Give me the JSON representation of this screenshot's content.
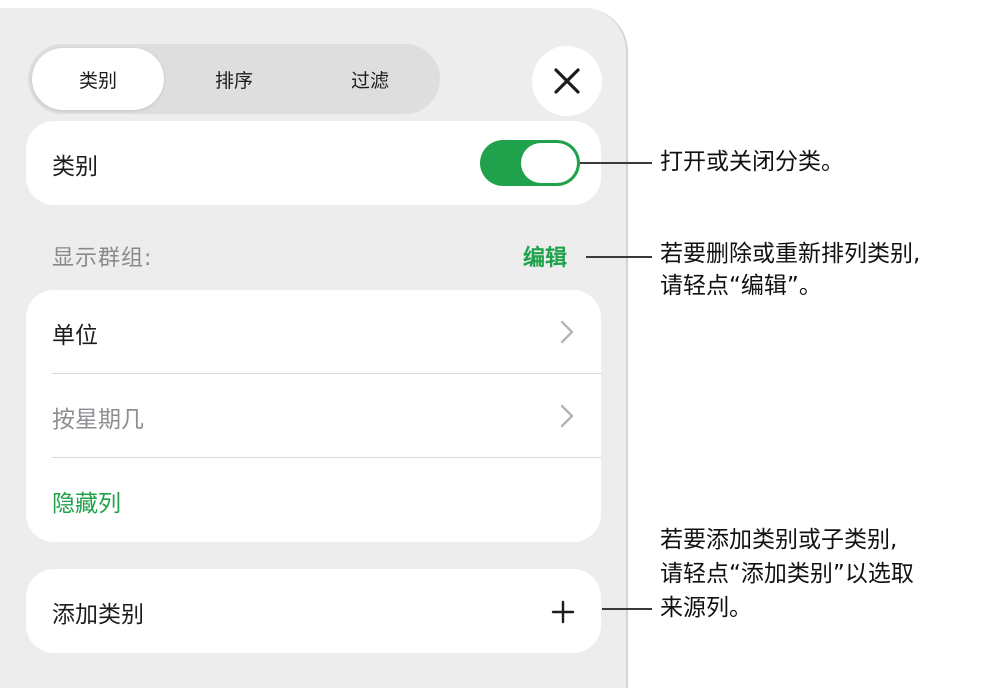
{
  "tabs": [
    {
      "label": "类别",
      "active": true
    },
    {
      "label": "排序",
      "active": false
    },
    {
      "label": "过滤",
      "active": false
    }
  ],
  "close_icon": "close-icon",
  "category_row": {
    "label": "类别",
    "toggle_on": true
  },
  "group_section": {
    "header": "显示群组:",
    "edit_label": "编辑"
  },
  "group_rows": [
    {
      "label": "单位",
      "dimmed": false
    },
    {
      "label": "按星期几",
      "dimmed": true
    }
  ],
  "hide_columns_label": "隐藏列",
  "add_category": {
    "label": "添加类别",
    "icon": "plus-icon"
  },
  "callouts": {
    "toggle": "打开或关闭分类。",
    "edit_line1": "若要删除或重新排列类别,",
    "edit_line2": "请轻点“编辑”。",
    "add_line1": "若要添加类别或子类别,",
    "add_line2": "请轻点“添加类别”以选取",
    "add_line3": "来源列。"
  },
  "colors": {
    "accent_green": "#1fa24b",
    "panel_bg": "#ededed"
  }
}
